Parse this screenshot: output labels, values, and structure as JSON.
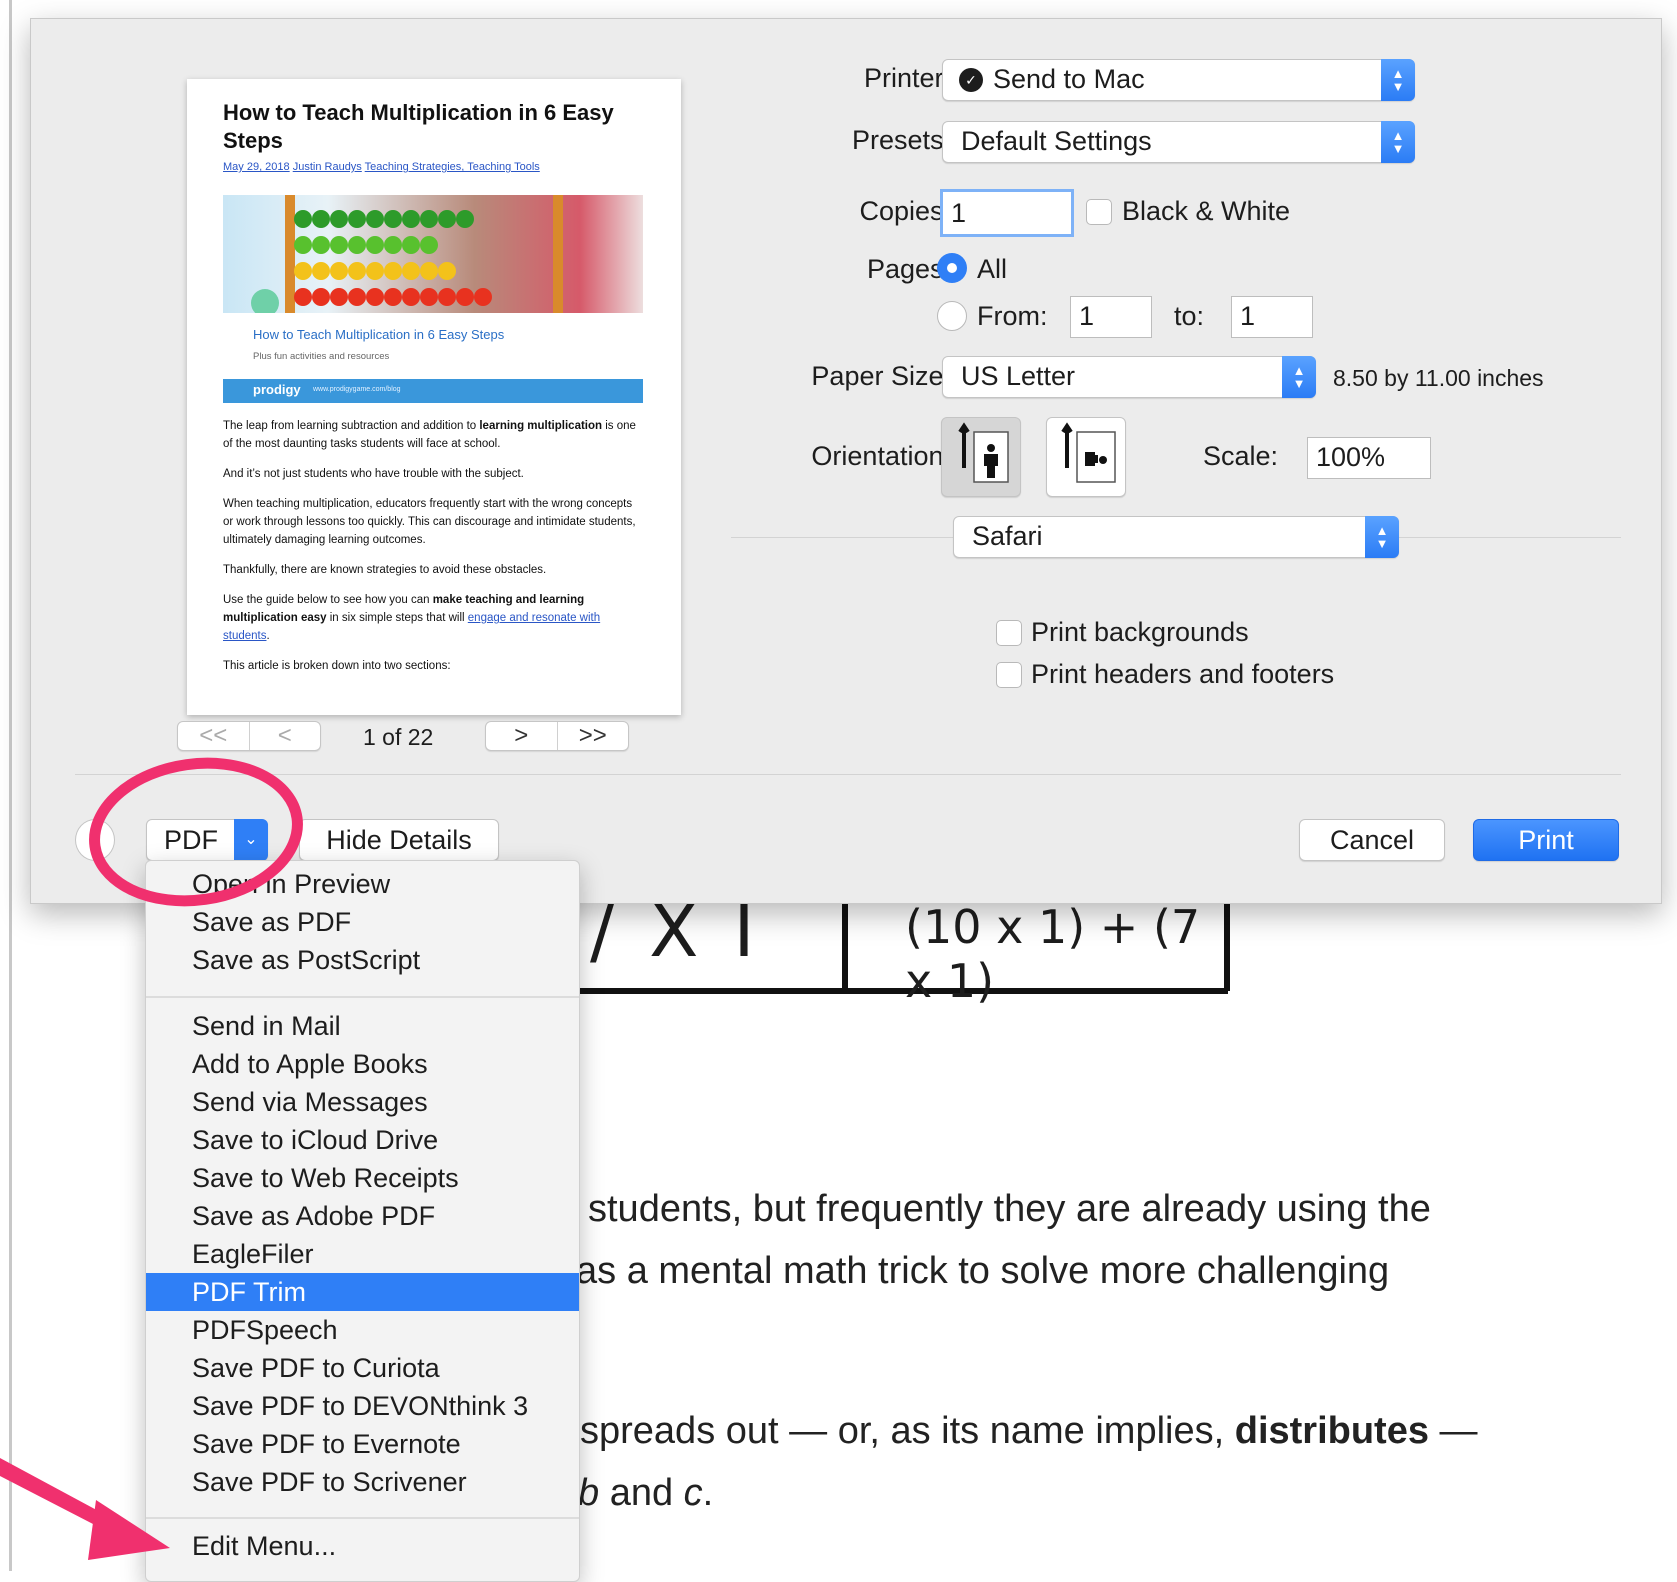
{
  "background_page": {
    "table_cell_1": "/ X I",
    "table_cell_2": "(10 x 1) + (7 x 1)",
    "line1": "students, but frequently they are already using the",
    "line2": "as a mental math trick to solve more challenging",
    "line3_a": "spreads out — or, as its name implies, ",
    "line3_bold": "distributes",
    "line3_b": " —",
    "line4_italic": "b",
    "line4_mid": " and ",
    "line4_italic2": "c",
    "line4_end": "."
  },
  "preview": {
    "title": "How to Teach Multiplication in 6 Easy Steps",
    "meta_date": "May 29, 2018",
    "meta_author": "Justin Raudys",
    "meta_cats": "Teaching Strategies, Teaching Tools",
    "banner_title": "How to Teach Multiplication in 6 Easy Steps",
    "banner_sub": "Plus fun activities and resources",
    "brand": "prodigy",
    "brand_url": "www.prodigygame.com/blog",
    "p1_a": "The leap from learning subtraction and addition to ",
    "p1_bold": "learning multiplication",
    "p1_b": " is one of the most daunting tasks students will face at school.",
    "p2": "And it’s not just students who have trouble with the subject.",
    "p3": "When teaching multiplication, educators frequently start with the wrong concepts or work through lessons too quickly. This can discourage and intimidate students, ultimately damaging learning outcomes.",
    "p4": "Thankfully, there are known strategies to avoid these obstacles.",
    "p5_a": "Use the guide below to see how you can ",
    "p5_bold": "make teaching and learning multiplication easy",
    "p5_b": " in six simple steps that will ",
    "p5_link": "engage and resonate with students",
    "p5_c": ".",
    "p6": "This article is broken down into two sections:"
  },
  "page_nav": {
    "first": "<<",
    "prev": "<",
    "next": ">",
    "last": ">>",
    "indicator": "1 of 22"
  },
  "form": {
    "printer_label": "Printer:",
    "printer_value": "Send to Mac",
    "presets_label": "Presets:",
    "presets_value": "Default Settings",
    "copies_label": "Copies:",
    "copies_value": "1",
    "bw_label": "Black & White",
    "pages_label": "Pages:",
    "pages_all": "All",
    "pages_from": "From:",
    "pages_from_value": "1",
    "pages_to": "to:",
    "pages_to_value": "1",
    "paper_label": "Paper Size:",
    "paper_value": "US Letter",
    "paper_dims": "8.50 by 11.00 inches",
    "orientation_label": "Orientation:",
    "scale_label": "Scale:",
    "scale_value": "100%",
    "app_section": "Safari",
    "print_backgrounds": "Print backgrounds",
    "print_headers": "Print headers and footers"
  },
  "footer": {
    "help": "?",
    "pdf": "PDF",
    "hide_details": "Hide Details",
    "cancel": "Cancel",
    "print": "Print"
  },
  "pdf_menu": {
    "group1": [
      "Open in Preview",
      "Save as PDF",
      "Save as PostScript"
    ],
    "group2": [
      "Send in Mail",
      "Add to Apple Books",
      "Send via Messages",
      "Save to iCloud Drive",
      "Save to Web Receipts",
      "Save as Adobe PDF",
      "EagleFiler",
      "PDF Trim",
      "PDFSpeech",
      "Save PDF to Curiota",
      "Save PDF to DEVONthink 3",
      "Save PDF to Evernote",
      "Save PDF to Scrivener"
    ],
    "selected": "PDF Trim",
    "edit": "Edit Menu..."
  },
  "colors": {
    "accent": "#2f7ff6",
    "annotation": "#f0306e",
    "dialog_bg": "#ececec"
  }
}
